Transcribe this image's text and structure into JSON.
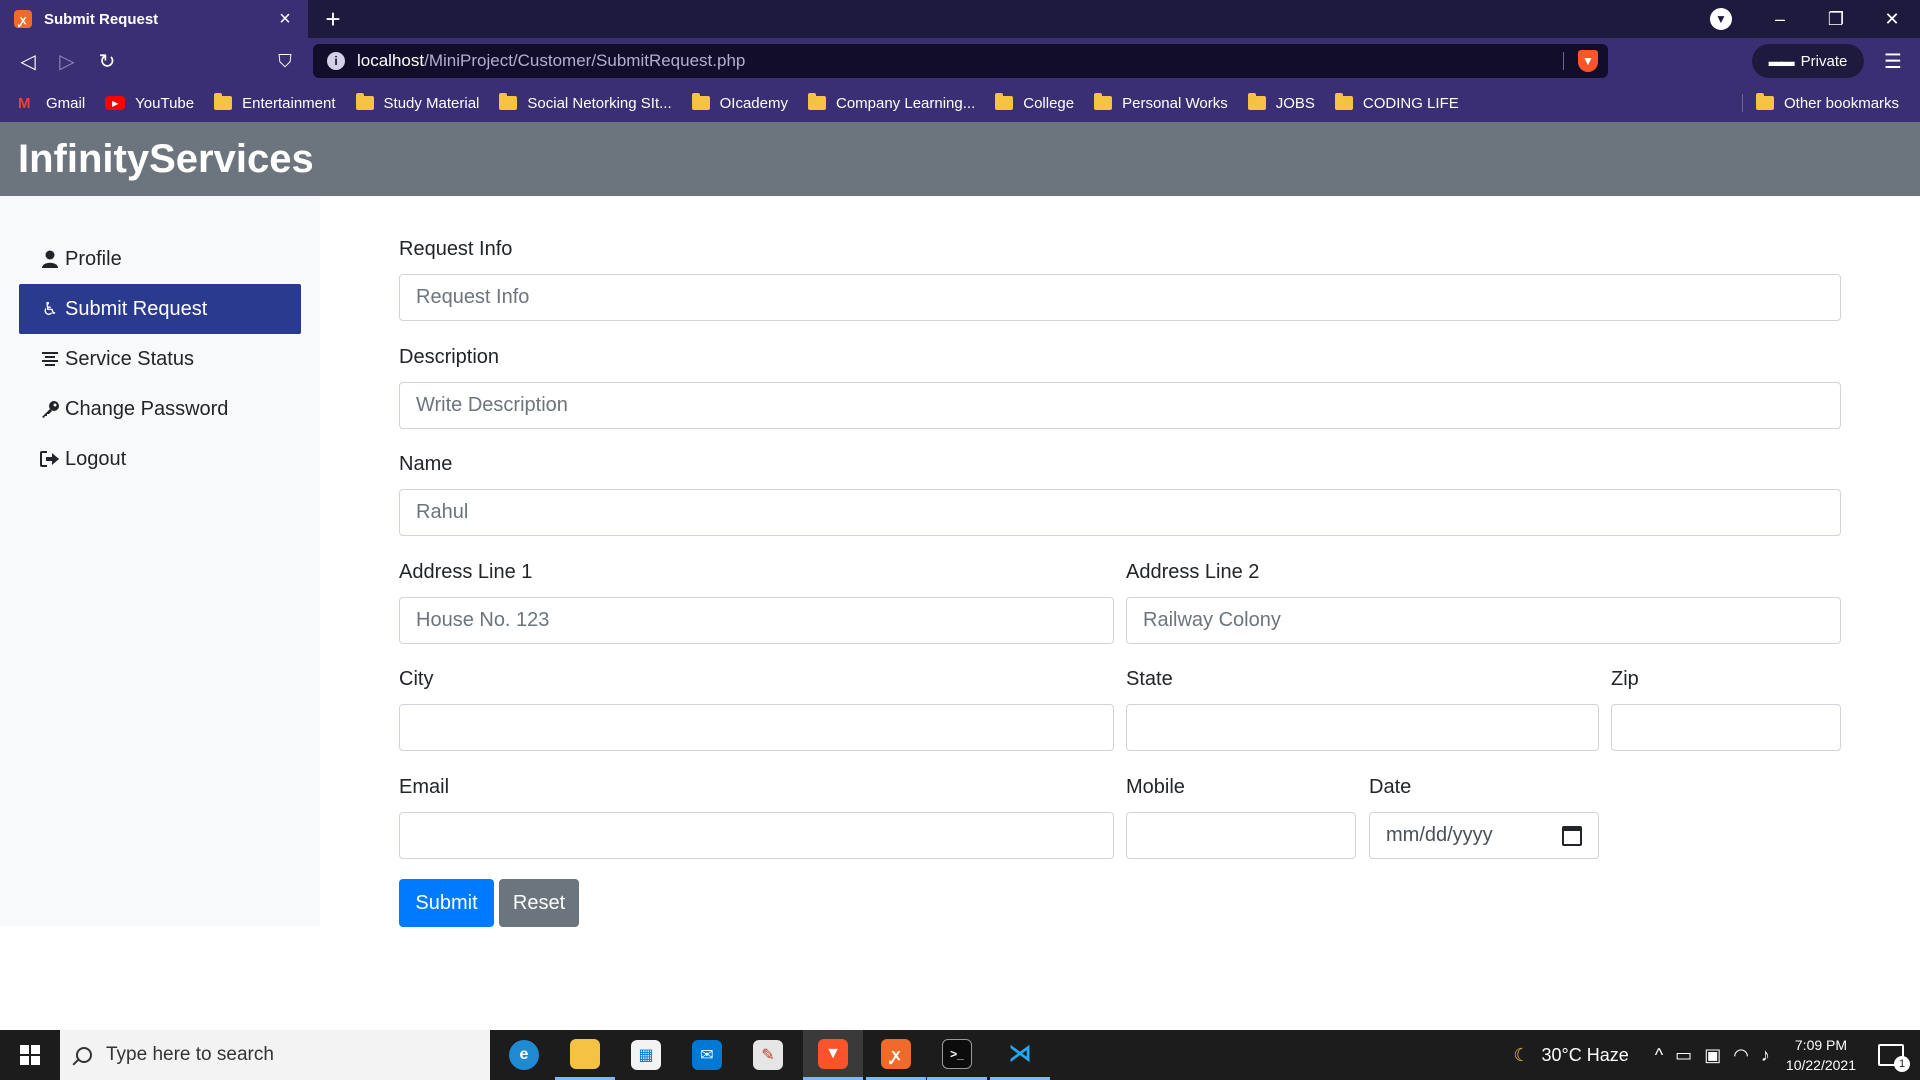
{
  "browser": {
    "tab_title": "Submit Request",
    "url_host": "localhost",
    "url_path": "/MiniProject/Customer/SubmitRequest.php",
    "private_label": "Private",
    "bookmarks": [
      {
        "label": "Gmail",
        "icon": "gmail-icon"
      },
      {
        "label": "YouTube",
        "icon": "youtube-icon"
      },
      {
        "label": "Entertainment",
        "icon": "folder-icon"
      },
      {
        "label": "Study Material",
        "icon": "folder-icon"
      },
      {
        "label": "Social Netorking SIt...",
        "icon": "folder-icon"
      },
      {
        "label": "OIcademy",
        "icon": "folder-icon"
      },
      {
        "label": "Company Learning...",
        "icon": "folder-icon"
      },
      {
        "label": "College",
        "icon": "folder-icon"
      },
      {
        "label": "Personal Works",
        "icon": "folder-icon"
      },
      {
        "label": "JOBS",
        "icon": "folder-icon"
      },
      {
        "label": "CODING LIFE",
        "icon": "folder-icon"
      }
    ],
    "other_bookmarks": "Other bookmarks"
  },
  "header": {
    "brand": "InfinityServices"
  },
  "sidebar": {
    "items": [
      {
        "label": "Profile",
        "icon": "user-icon",
        "active": false
      },
      {
        "label": "Submit Request",
        "icon": "accessibility-icon",
        "active": true
      },
      {
        "label": "Service Status",
        "icon": "align-center-icon",
        "active": false
      },
      {
        "label": "Change Password",
        "icon": "key-icon",
        "active": false
      },
      {
        "label": "Logout",
        "icon": "sign-out-icon",
        "active": false
      }
    ]
  },
  "form": {
    "request_info": {
      "label": "Request Info",
      "placeholder": "Request Info",
      "value": ""
    },
    "description": {
      "label": "Description",
      "placeholder": "Write Description",
      "value": ""
    },
    "name": {
      "label": "Name",
      "placeholder": "Rahul",
      "value": ""
    },
    "address1": {
      "label": "Address Line 1",
      "placeholder": "House No. 123",
      "value": ""
    },
    "address2": {
      "label": "Address Line 2",
      "placeholder": "Railway Colony",
      "value": ""
    },
    "city": {
      "label": "City",
      "value": ""
    },
    "state": {
      "label": "State",
      "value": ""
    },
    "zip": {
      "label": "Zip",
      "value": ""
    },
    "email": {
      "label": "Email",
      "value": ""
    },
    "mobile": {
      "label": "Mobile",
      "value": ""
    },
    "date": {
      "label": "Date",
      "placeholder": "mm/dd/yyyy"
    },
    "submit_label": "Submit",
    "reset_label": "Reset"
  },
  "taskbar": {
    "search_placeholder": "Type here to search",
    "weather": "30°C  Haze",
    "time": "7:09 PM",
    "date": "10/22/2021",
    "notification_count": "1"
  },
  "colors": {
    "header_bg": "#6c757d",
    "sidebar_active": "#2a3a8f",
    "primary": "#007bff",
    "secondary": "#6c757d",
    "browser_chrome": "#3b2f74"
  }
}
